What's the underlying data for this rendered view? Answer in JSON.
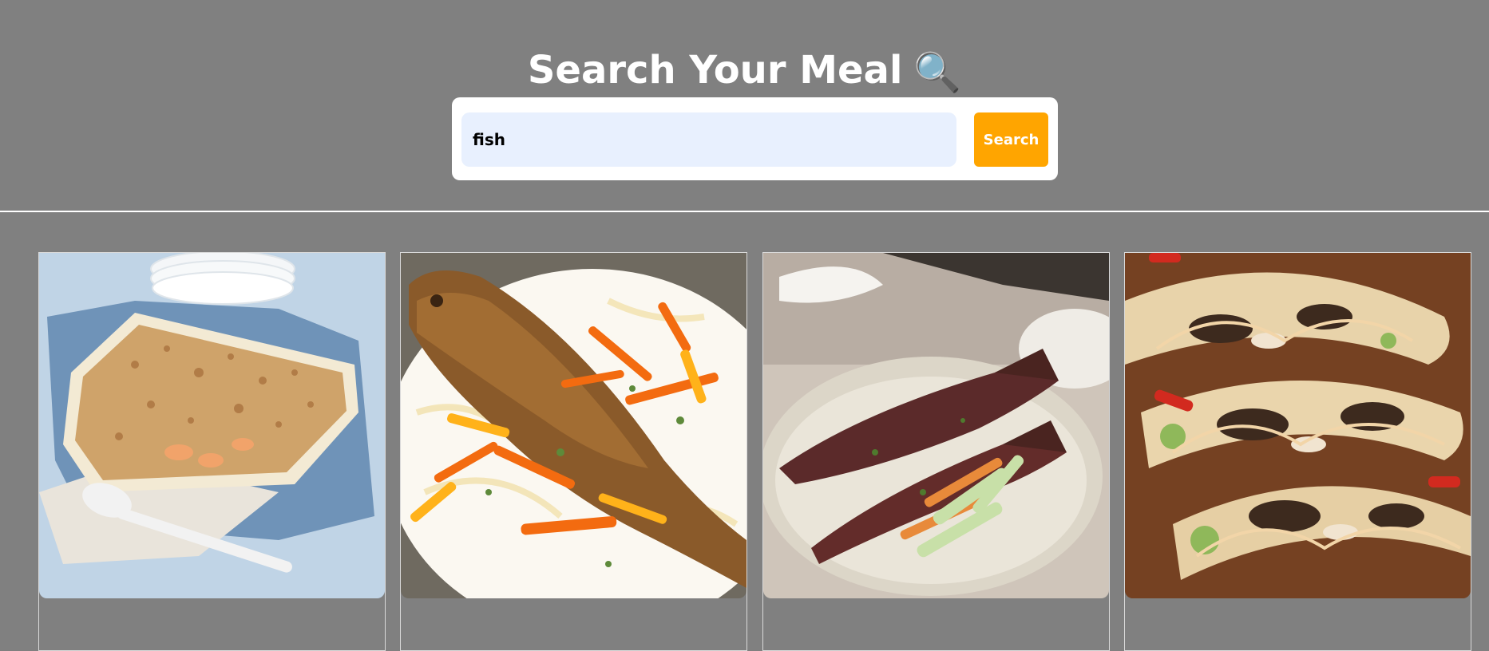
{
  "header": {
    "title": "Search Your Meal",
    "title_icon": "magnifying-glass-emoji",
    "title_icon_glyph": "🔍"
  },
  "search": {
    "value": "fish",
    "button_label": "Search",
    "accent_color": "#ffa500",
    "input_bg": "#e8f0fe"
  },
  "results": {
    "meals": [
      {
        "image": "fish-pie-photo"
      },
      {
        "image": "whole-fried-fish-with-carrots-photo"
      },
      {
        "image": "spiced-fish-with-vegetables-photo"
      },
      {
        "image": "fish-tacos-photo"
      }
    ]
  },
  "colors": {
    "page_bg": "#808080",
    "divider": "#ffffff",
    "card_border": "#d9d9d9"
  }
}
